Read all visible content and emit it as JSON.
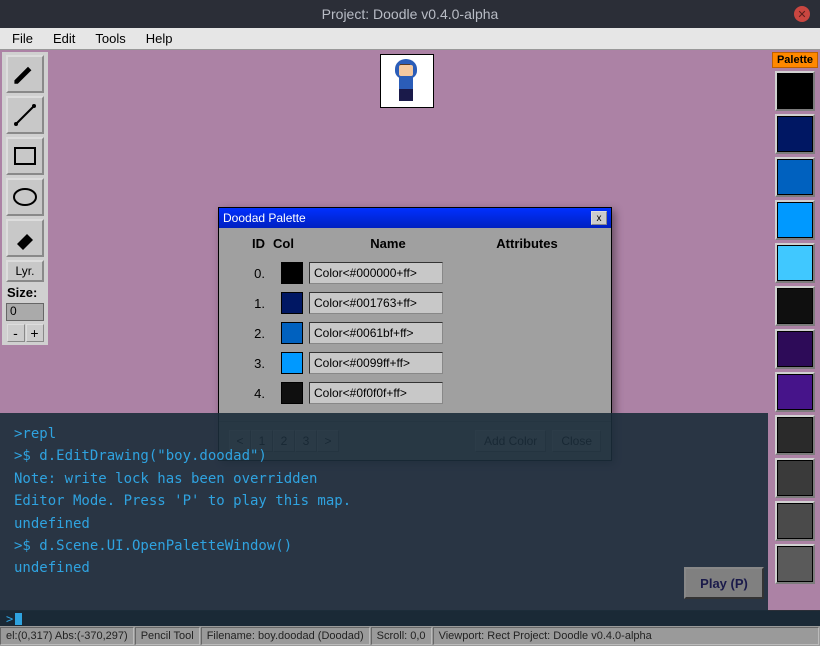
{
  "window": {
    "title": "Project: Doodle v0.4.0-alpha"
  },
  "menu": {
    "file": "File",
    "edit": "Edit",
    "tools": "Tools",
    "help": "Help"
  },
  "toolbar": {
    "lyr_label": "Lyr.",
    "size_label": "Size:",
    "size_value": "0",
    "minus": "-",
    "plus": "+"
  },
  "palette_panel": {
    "header": "Palette",
    "swatches": [
      "#000000",
      "#001763",
      "#0061bf",
      "#0099ff",
      "#40c8ff",
      "#0f0f0f",
      "#2d0b58",
      "#46148a",
      "#2a2a2a",
      "#3a3a3a",
      "#4a4a4a",
      "#5a5a5a"
    ]
  },
  "dialog": {
    "title": "Doodad Palette",
    "headers": {
      "id": "ID",
      "col": "Col",
      "name": "Name",
      "attributes": "Attributes"
    },
    "rows": [
      {
        "id": "0.",
        "color": "#000000",
        "name": "Color<#000000+ff>"
      },
      {
        "id": "1.",
        "color": "#001763",
        "name": "Color<#001763+ff>"
      },
      {
        "id": "2.",
        "color": "#0061bf",
        "name": "Color<#0061bf+ff>"
      },
      {
        "id": "3.",
        "color": "#0099ff",
        "name": "Color<#0099ff+ff>"
      },
      {
        "id": "4.",
        "color": "#0f0f0f",
        "name": "Color<#0f0f0f+ff>"
      }
    ],
    "pager": {
      "prev": "<",
      "p1": "1",
      "p2": "2",
      "p3": "3",
      "next": ">"
    },
    "add_color_label": "Add Color",
    "close_label": "Close"
  },
  "console": {
    "lines": [
      ">repl",
      ">$ d.EditDrawing(\"boy.doodad\")",
      "Note: write lock has been overridden",
      "Editor Mode. Press 'P' to play this map.",
      "undefined",
      ">$ d.Scene.UI.OpenPaletteWindow()",
      "undefined"
    ]
  },
  "play_button": "Play (P)",
  "repl_prompt": ">",
  "statusbar": {
    "coords": "el:(0,317)  Abs:(-370,297)",
    "tool": "Pencil Tool",
    "filename": "Filename: boy.doodad (Doodad)",
    "scroll": "Scroll: 0,0",
    "viewport": "Viewport: Rect Project: Doodle v0.4.0-alpha"
  }
}
